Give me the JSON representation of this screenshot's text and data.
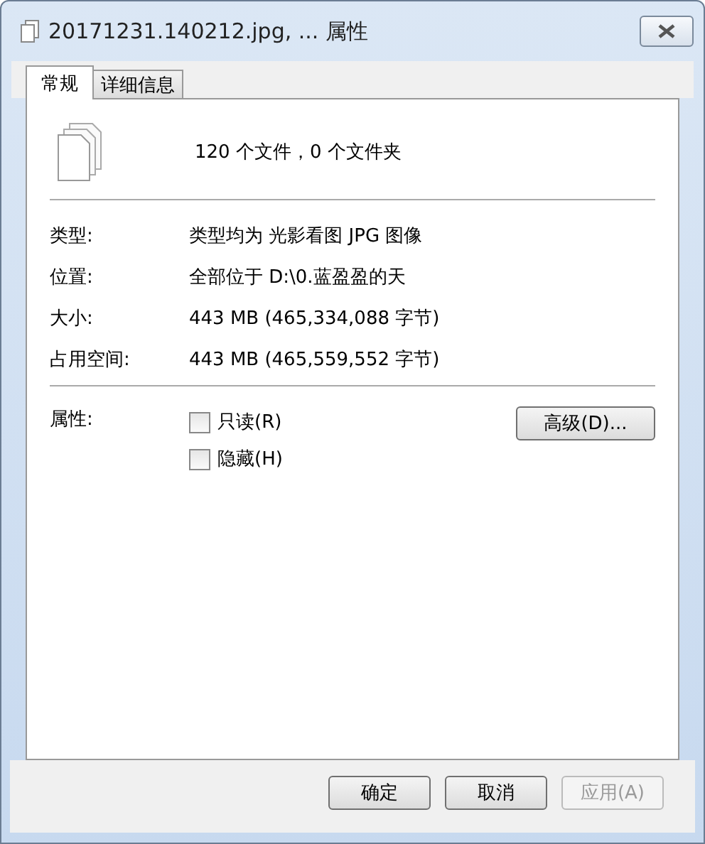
{
  "window": {
    "title": "20171231.140212.jpg, ... 属性"
  },
  "tabs": [
    {
      "label": "常规",
      "selected": true
    },
    {
      "label": "详细信息",
      "selected": false
    }
  ],
  "summary": "120 个文件，0 个文件夹",
  "info": [
    {
      "label": "类型:",
      "value": "类型均为 光影看图 JPG 图像"
    },
    {
      "label": "位置:",
      "value": "全部位于 D:\\0.蓝盈盈的天"
    },
    {
      "label": "大小:",
      "value": "443 MB (465,334,088 字节)"
    },
    {
      "label": "占用空间:",
      "value": "443 MB (465,559,552 字节)"
    }
  ],
  "attributes": {
    "label": "属性:",
    "options": [
      {
        "label": "只读(R)",
        "checked": false
      },
      {
        "label": "隐藏(H)",
        "checked": false
      }
    ],
    "advanced_button": "高级(D)..."
  },
  "buttons": [
    {
      "label": "确定",
      "disabled": false
    },
    {
      "label": "取消",
      "disabled": false
    },
    {
      "label": "应用(A)",
      "disabled": true
    }
  ]
}
